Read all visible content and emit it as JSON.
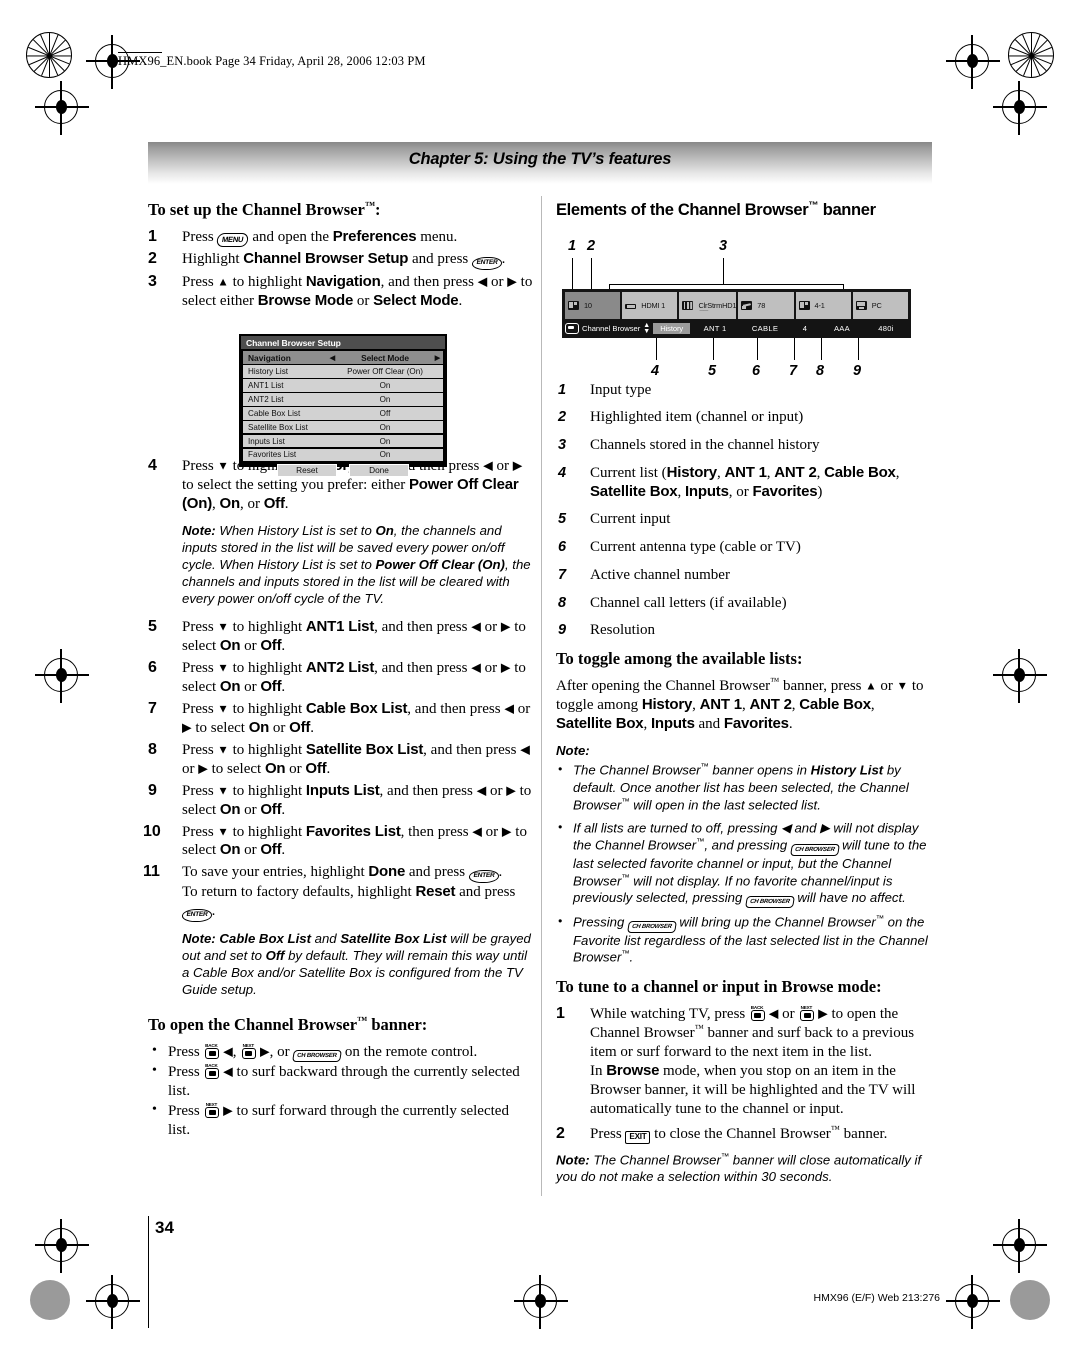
{
  "slug": "HMX96_EN.book  Page 34  Friday, April 28, 2006  12:03 PM",
  "chapter_header": "Chapter 5: Using the TV’s features",
  "page_number": "34",
  "footer_code": "HMX96 (E/F) Web 213:276",
  "left": {
    "heading1": "To set up the Channel Browser™:",
    "steps": [
      {
        "n": "1",
        "html": "Press <span class=\"key menu\" data-name=\"menu-key-icon\">MENU</span> and open the <b class=\"sans\">Preferences</b> menu."
      },
      {
        "n": "2",
        "html": "Highlight <b class=\"sans\">Channel Browser Setup</b> and press <span class=\"key enter\" data-name=\"enter-key-icon\">ENTER</span>."
      },
      {
        "n": "3",
        "html": "Press <span class=\"arrud\">▲</span> to highlight <b class=\"sans\">Navigation</b>, and then press <span class=\"arr\">◀</span> or <span class=\"arr\">▶</span> to select either <b class=\"sans\">Browse Mode</b> or <b class=\"sans\">Select Mode</b>."
      }
    ],
    "osd": {
      "title": "Channel Browser Setup",
      "nav_label": "Navigation",
      "nav_left_arrow": "◀",
      "nav_value": "Select Mode",
      "nav_right_arrow": "▶",
      "rows": [
        {
          "label": "History List",
          "value": "Power Off Clear (On)"
        },
        {
          "label": "ANT1 List",
          "value": "On"
        },
        {
          "label": "ANT2 List",
          "value": "On"
        },
        {
          "label": "Cable Box List",
          "value": "Off"
        },
        {
          "label": "Satellite Box List",
          "value": "On"
        },
        {
          "label": "Inputs List",
          "value": "On"
        },
        {
          "label": "Favorites List",
          "value": "On"
        }
      ],
      "reset_label": "Reset",
      "done_label": "Done"
    },
    "steps2": [
      {
        "n": "4",
        "html": "Press <span class=\"arrud\">▼</span> to highlight <b class=\"sans\">History List</b>, and then press <span class=\"arr\">◀</span> or <span class=\"arr\">▶</span> to select the setting you prefer: either <b class=\"sans\">Power Off Clear (On)</b>, <b class=\"sans\">On</b>, or <b class=\"sans\">Off</b>."
      },
      {
        "n": "5",
        "html": "Press <span class=\"arrud\">▼</span> to highlight <b class=\"sans\">ANT1 List</b>, and then press <span class=\"arr\">◀</span> or <span class=\"arr\">▶</span> to select <b class=\"sans\">On</b> or <b class=\"sans\">Off</b>."
      },
      {
        "n": "6",
        "html": "Press <span class=\"arrud\">▼</span> to highlight <b class=\"sans\">ANT2 List</b>, and then press <span class=\"arr\">◀</span> or <span class=\"arr\">▶</span> to select <b class=\"sans\">On</b> or <b class=\"sans\">Off</b>."
      },
      {
        "n": "7",
        "html": "Press <span class=\"arrud\">▼</span> to highlight <b class=\"sans\">Cable Box List</b>, and then press <span class=\"arr\">◀</span> or <span class=\"arr\">▶</span> to select <b class=\"sans\">On</b> or <b class=\"sans\">Off</b>."
      },
      {
        "n": "8",
        "html": "Press <span class=\"arrud\">▼</span> to highlight <b class=\"sans\">Satellite Box List</b>, and then press <span class=\"arr\">◀</span> or <span class=\"arr\">▶</span> to select <b class=\"sans\">On</b> or <b class=\"sans\">Off</b>."
      },
      {
        "n": "9",
        "html": "Press <span class=\"arrud\">▼</span> to highlight <b class=\"sans\">Inputs List</b>, and then press <span class=\"arr\">◀</span> or <span class=\"arr\">▶</span> to select <b class=\"sans\">On</b> or <b class=\"sans\">Off</b>."
      },
      {
        "n": "10",
        "html": "Press <span class=\"arrud\">▼</span> to highlight <b class=\"sans\">Favorites List</b>, then press <span class=\"arr\">◀</span> or <span class=\"arr\">▶</span> to select <b class=\"sans\">On</b> or <b class=\"sans\">Off</b>."
      },
      {
        "n": "11",
        "html": "To save your entries, highlight <b class=\"sans\">Done</b> and press <span class=\"key enter\" data-name=\"enter-key-icon\">ENTER</span>.<br>To return to factory defaults, highlight <b class=\"sans\">Reset</b> and press <span class=\"key enter\" data-name=\"enter-key-icon\">ENTER</span>."
      }
    ],
    "note_history_html": "<b>Note:</b> When History List is set to <b>On</b>, the channels and inputs stored in the list will be saved every power on/off cycle. When History List is set to <b>Power Off Clear (On)</b>, the channels and inputs stored in the list will be cleared with every power on/off cycle of the TV.",
    "note_cablebox_html": "<b>Note: Cable Box List</b> and <b>Satellite Box List</b> will be grayed out and set to <b>Off</b> by default. They will remain this way until a Cable Box and/or Satellite Box is configured from the TV Guide setup.",
    "heading2": "To open the Channel Browser™ banner:",
    "bullets": [
      "Press <span class=\"ch\" data-name=\"channel-back-key-icon\"><span class=\"lbl\">BACK</span><span class=\"bod\"></span></span> <span class=\"arr\">◀</span>, <span class=\"ch\" data-name=\"channel-next-key-icon\"><span class=\"lbl\">NEXT</span><span class=\"bod\"></span></span> <span class=\"arr\">▶</span>, or <span class=\"key browser\" data-name=\"ch-browser-key-icon\">CH BROWSER</span> on the remote control.",
      "Press <span class=\"ch\" data-name=\"channel-back-key-icon\"><span class=\"lbl\">BACK</span><span class=\"bod\"></span></span> <span class=\"arr\">◀</span> to surf backward through the currently selected list.",
      "Press <span class=\"ch\" data-name=\"channel-next-key-icon\"><span class=\"lbl\">NEXT</span><span class=\"bod\"></span></span> <span class=\"arr\">▶</span> to surf forward through the currently selected list."
    ]
  },
  "right": {
    "heading1": "Elements of the Channel Browser™ banner",
    "banner": {
      "callout_labels_top": [
        "1",
        "2",
        "3"
      ],
      "callout_labels_bottom": [
        "4",
        "5",
        "6",
        "7",
        "8",
        "9"
      ],
      "tiles": [
        {
          "icon": "tv-icon",
          "label": "10",
          "sub": "",
          "selected": true
        },
        {
          "icon": "hdmi-icon",
          "label": "HDMI 1",
          "sub": "",
          "selected": false
        },
        {
          "icon": "stream-icon",
          "label": "ClrStrmHD1",
          "sub": "——",
          "selected": false
        },
        {
          "icon": "cable-icon",
          "label": "78",
          "sub": "",
          "selected": false
        },
        {
          "icon": "tv-icon",
          "label": "4-1",
          "sub": "",
          "selected": false
        },
        {
          "icon": "pc-icon",
          "label": "PC",
          "sub": "",
          "selected": false
        }
      ],
      "bottom_bar": {
        "logo_label": "CB",
        "title": "Channel Browser",
        "current_list": "History",
        "input": "ANT 1",
        "antenna": "CABLE",
        "channel": "4",
        "call_letters": "AAA",
        "resolution": "480i"
      }
    },
    "callouts": [
      {
        "n": "1",
        "html": "Input type"
      },
      {
        "n": "2",
        "html": "Highlighted item (channel or input)"
      },
      {
        "n": "3",
        "html": "Channels stored in the channel history"
      },
      {
        "n": "4",
        "html": "Current list (<b class=\"sans\">History</b>, <b class=\"sans\">ANT 1</b>, <b class=\"sans\">ANT 2</b>, <b class=\"sans\">Cable Box</b>, <b class=\"sans\">Satellite Box</b>, <b class=\"sans\">Inputs</b>, or <b class=\"sans\">Favorites</b>)"
      },
      {
        "n": "5",
        "html": "Current input"
      },
      {
        "n": "6",
        "html": "Current antenna type (cable or TV)"
      },
      {
        "n": "7",
        "html": "Active channel number"
      },
      {
        "n": "8",
        "html": "Channel call letters (if available)"
      },
      {
        "n": "9",
        "html": "Resolution"
      }
    ],
    "heading2": "To toggle among the available lists:",
    "toggle_body_html": "After opening the Channel Browser<span class=\"tm\">™</span> banner, press <span class=\"arrud\">▲</span> or <span class=\"arrud\">▼</span> to toggle among <b class=\"sans\">History</b>, <b class=\"sans\">ANT 1</b>, <b class=\"sans\">ANT 2</b>, <b class=\"sans\">Cable Box</b>, <b class=\"sans\">Satellite Box</b>, <b class=\"sans\">Inputs</b> and <b class=\"sans\">Favorites</b>.",
    "note_label": "Note:",
    "note_bullets": [
      "The Channel Browser<span class=\"tm\">™</span> banner opens in <b>History List</b> by default. Once another list has been selected, the Channel Browser<span class=\"tm\">™</span> will open in the last selected list.",
      "If all lists are turned to off, pressing <span class=\"arr\">◀</span> and <span class=\"arr\">▶</span> will not display the Channel Browser<span class=\"tm\">™</span>, and pressing <span class=\"key browser\" data-name=\"ch-browser-key-icon\">CH BROWSER</span> will tune to the last selected favorite channel or input, but the Channel Browser<span class=\"tm\">™</span>  will not display.  If no favorite channel/input is previously selected, pressing <span class=\"key browser\" data-name=\"ch-browser-key-icon\">CH BROWSER</span> will have no affect.",
      "Pressing <span class=\"key browser\" data-name=\"ch-browser-key-icon\">CH BROWSER</span> will bring up the Channel Browser<span class=\"tm\">™</span> on the Favorite list regardless of the last selected list in the Channel Browser<span class=\"tm\">™</span>."
    ],
    "heading3": "To tune to a channel or input in Browse mode:",
    "tune_steps": [
      {
        "n": "1",
        "html": "While watching TV, press <span class=\"ch\" data-name=\"channel-back-key-icon\"><span class=\"lbl\">BACK</span><span class=\"bod\"></span></span> <span class=\"arr\">◀</span> or <span class=\"ch\" data-name=\"channel-next-key-icon\"><span class=\"lbl\">NEXT</span><span class=\"bod\"></span></span> <span class=\"arr\">▶</span> to open the Channel Browser<span class=\"tm\">™</span> banner and surf back to a previous item or surf forward to the next item in the list.<br>In <b class=\"sans\">Browse</b> mode, when you stop on an item in the Browser banner, it will be highlighted and the TV will automatically tune to the channel or input."
      },
      {
        "n": "2",
        "html": "Press <span class=\"key exit\" data-name=\"exit-key-icon\">EXIT</span> to close the Channel Browser<span class=\"tm\">™</span> banner."
      }
    ],
    "note_close_html": "<b>Note:</b> The Channel Browser<span class=\"tm\">™</span> banner will close automatically if you do not make a selection within 30 seconds."
  }
}
